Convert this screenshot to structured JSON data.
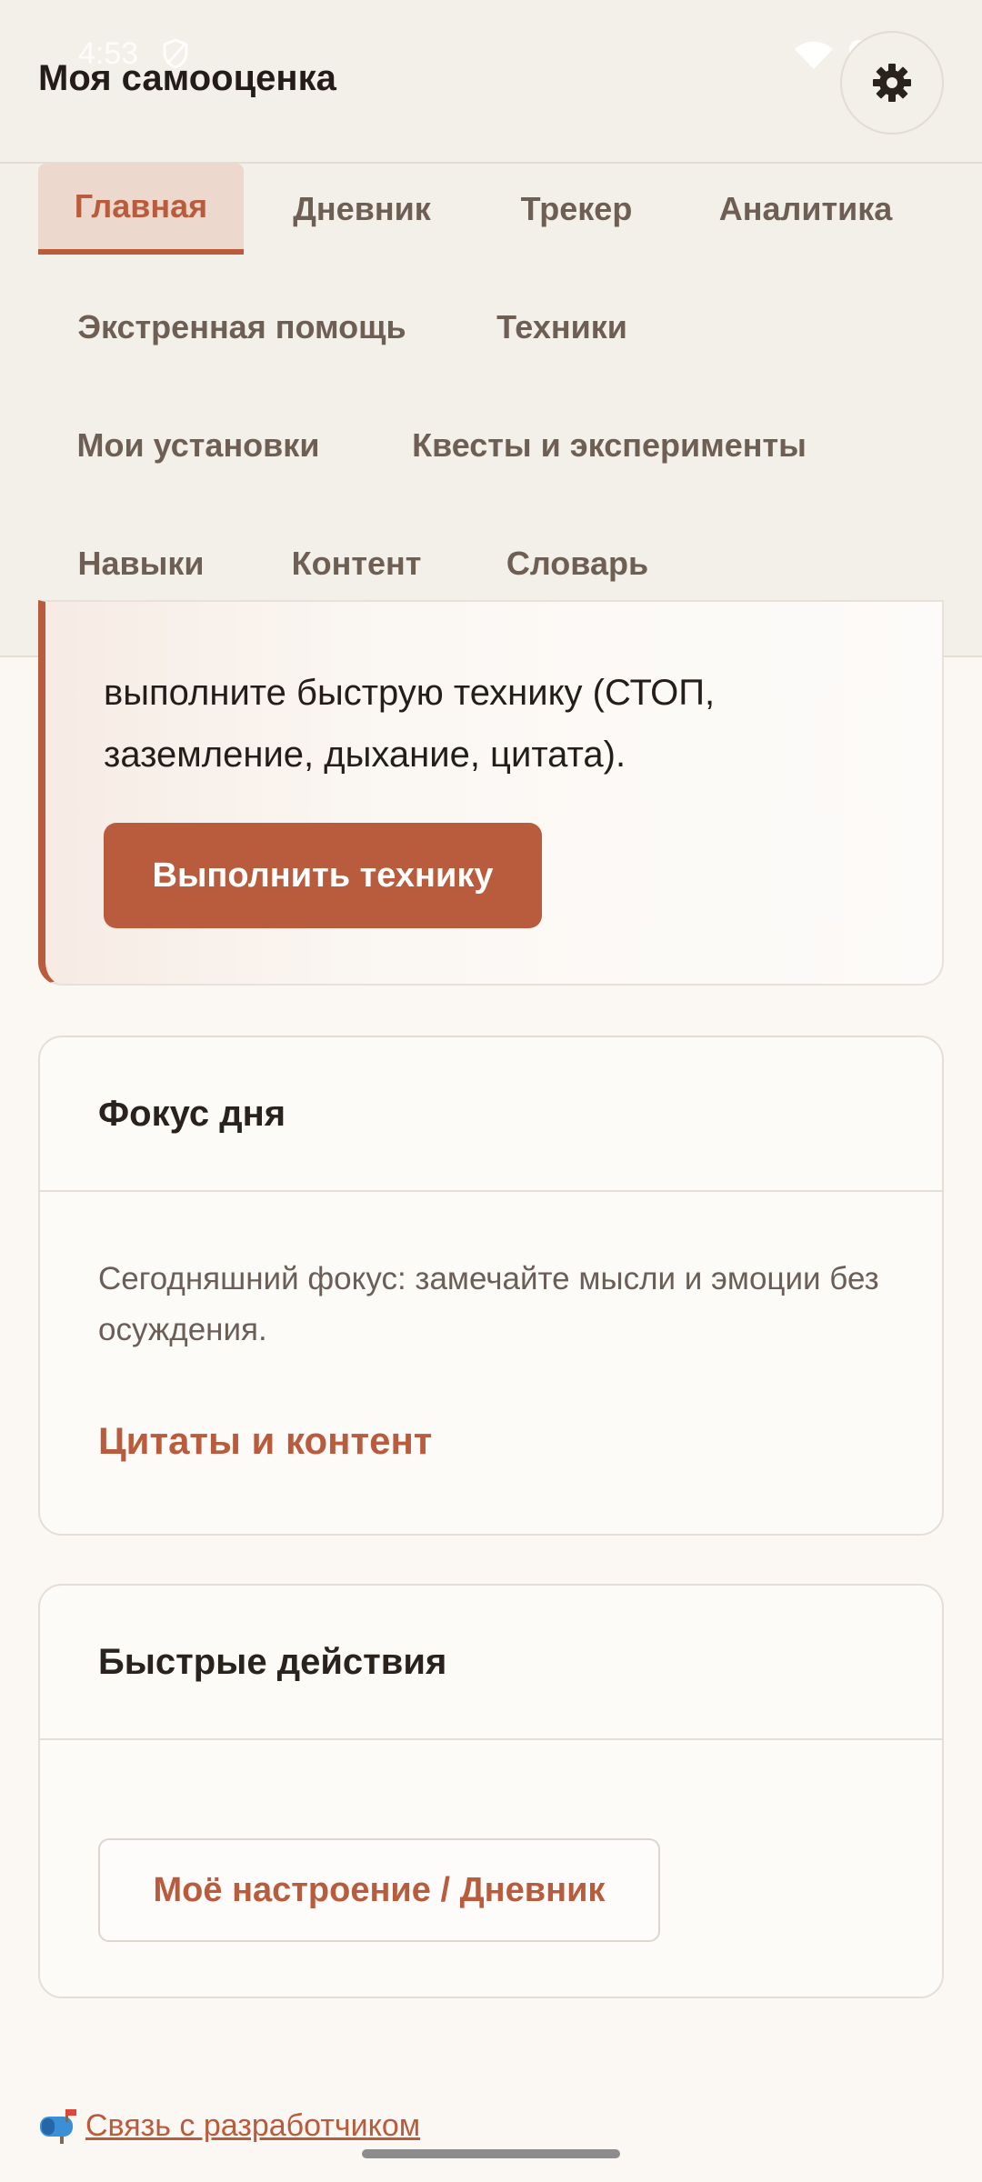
{
  "status_bar": {
    "time": "4:53"
  },
  "header": {
    "title": "Моя самооценка"
  },
  "nav": {
    "tabs": [
      {
        "label": "Главная",
        "active": true
      },
      {
        "label": "Дневник"
      },
      {
        "label": "Трекер"
      },
      {
        "label": "Аналитика"
      },
      {
        "label": "Экстренная помощь"
      },
      {
        "label": "Техники"
      },
      {
        "label": "Мои установки"
      },
      {
        "label": "Квесты и эксперименты"
      },
      {
        "label": "Навыки"
      },
      {
        "label": "Контент"
      },
      {
        "label": "Словарь"
      }
    ]
  },
  "technique_card": {
    "text_line1": "выполните быструю технику (СТОП,",
    "text_line2": "заземление, дыхание, цитата).",
    "button_label": "Выполнить технику"
  },
  "focus_card": {
    "title": "Фокус дня",
    "text": "Сегодняшний фокус: замечайте мысли и эмоции без осуждения.",
    "link": "Цитаты и контент"
  },
  "quick_actions": {
    "title": "Быстрые действия",
    "button_label": "Моё настроение / Дневник"
  },
  "footer": {
    "dev_link": "Связь с разработчиком"
  },
  "colors": {
    "accent": "#b95c3d",
    "background": "#fbf8f4",
    "nav_background": "#f3efe9",
    "active_tab_background": "#ecd8cc"
  }
}
